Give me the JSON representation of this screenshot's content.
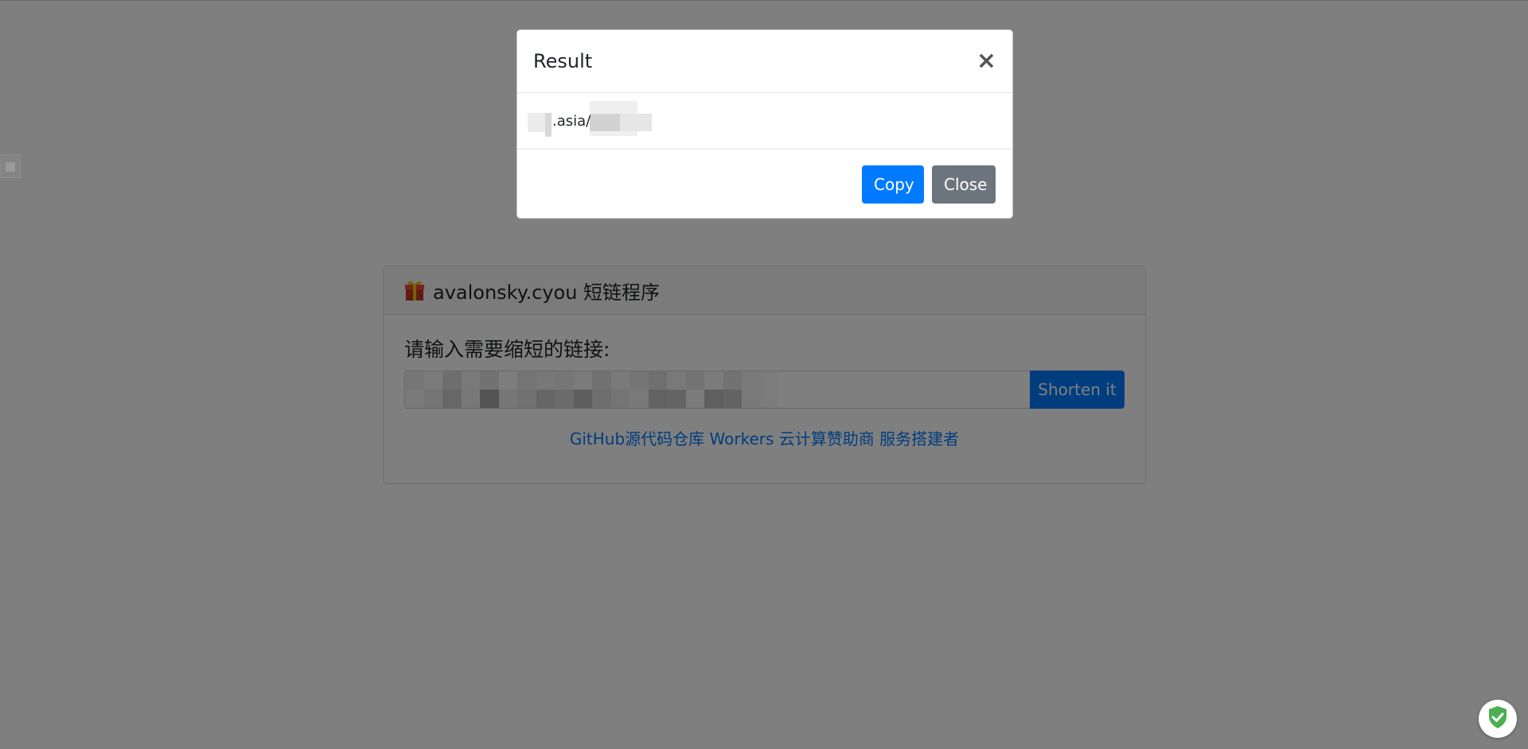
{
  "card": {
    "header_title": "avalonsky.cyou 短链程序",
    "prompt": "请输入需要缩短的链接:",
    "shorten_label": "Shorten it",
    "footer_links": [
      "GitHub源代码仓库",
      "Workers 云计算赞助商",
      "服务搭建者"
    ]
  },
  "modal": {
    "title": "Result",
    "close_glyph": "×",
    "result_visible": ".asia/",
    "copy_label": "Copy",
    "close_label": "Close"
  },
  "colors": {
    "primary": "#007bff",
    "secondary": "#6c757d",
    "shield_green": "#4caf50"
  },
  "icons": {
    "gift": "gift-icon",
    "close": "close-icon",
    "shield": "shield-check-icon"
  }
}
